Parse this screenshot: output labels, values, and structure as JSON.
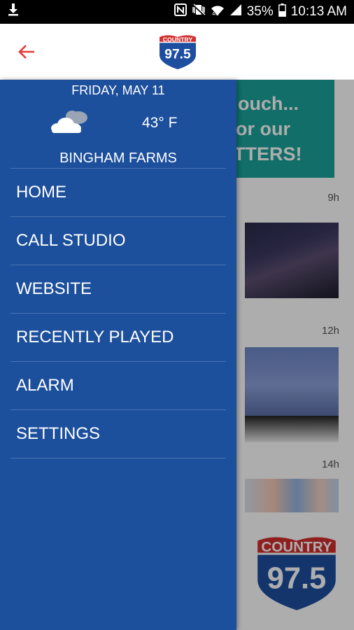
{
  "status_bar": {
    "battery": "35%",
    "time": "10:13 AM",
    "icons": [
      "download-icon",
      "nfc-icon",
      "vibrate-icon",
      "wifi-icon",
      "signal-icon",
      "battery-icon"
    ]
  },
  "header": {
    "back_icon": "arrow-left-icon",
    "logo": {
      "top": "COUNTRY",
      "number": "97.5"
    },
    "accent_color": "#e53935"
  },
  "drawer": {
    "date": "FRIDAY, MAY 11",
    "weather_icon": "cloudy-icon",
    "temperature": "43° F",
    "location": "BINGHAM FARMS",
    "background_color": "#1c4f9c",
    "items": [
      {
        "label": "HOME"
      },
      {
        "label": "CALL STUDIO"
      },
      {
        "label": "WEBSITE"
      },
      {
        "label": "RECENTLY PLAYED"
      },
      {
        "label": "ALARM"
      },
      {
        "label": "SETTINGS"
      }
    ]
  },
  "feed": {
    "promo_lines": [
      "ouch...",
      "or our",
      "TTERS!"
    ],
    "promo_color": "#1aa39a",
    "posts": [
      {
        "time": "9h"
      },
      {
        "time": "12h"
      },
      {
        "time": "14h"
      }
    ],
    "logo": {
      "top": "COUNTRY",
      "number": "97.5"
    }
  }
}
